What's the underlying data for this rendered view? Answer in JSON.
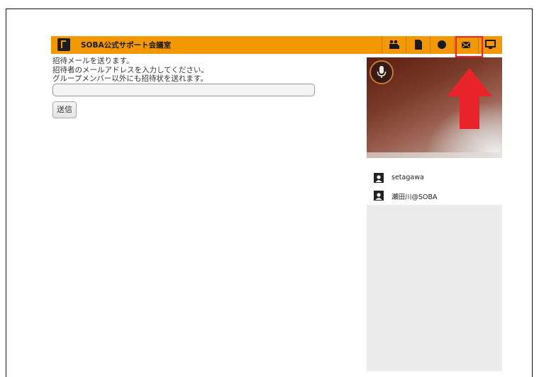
{
  "header": {
    "title": "SOBA公式サポート会議室",
    "exit_icon": "exit-door-icon",
    "accent_color": "#f39800",
    "buttons": [
      {
        "name": "members-button",
        "icon": "people-icon"
      },
      {
        "name": "document-button",
        "icon": "document-icon"
      },
      {
        "name": "record-button",
        "icon": "record-circle-icon"
      },
      {
        "name": "invite-mail-button",
        "icon": "envelope-icon"
      },
      {
        "name": "screen-share-button",
        "icon": "monitor-icon"
      }
    ]
  },
  "invite": {
    "lines": [
      "招待メールを送ります。",
      "招待者のメールアドレスを入力してください。",
      "グループメンバー以外にも招待状を送れます。"
    ],
    "email_value": "",
    "send_label": "送信"
  },
  "video": {
    "mic_icon": "microphone-icon"
  },
  "members": [
    {
      "name": "setagawa",
      "icon": "user-icon"
    },
    {
      "name": "瀬田川@SOBA",
      "icon": "user-icon"
    }
  ],
  "annotation": {
    "highlight_color": "#e8232a",
    "arrow_icon": "arrow-up-icon"
  }
}
